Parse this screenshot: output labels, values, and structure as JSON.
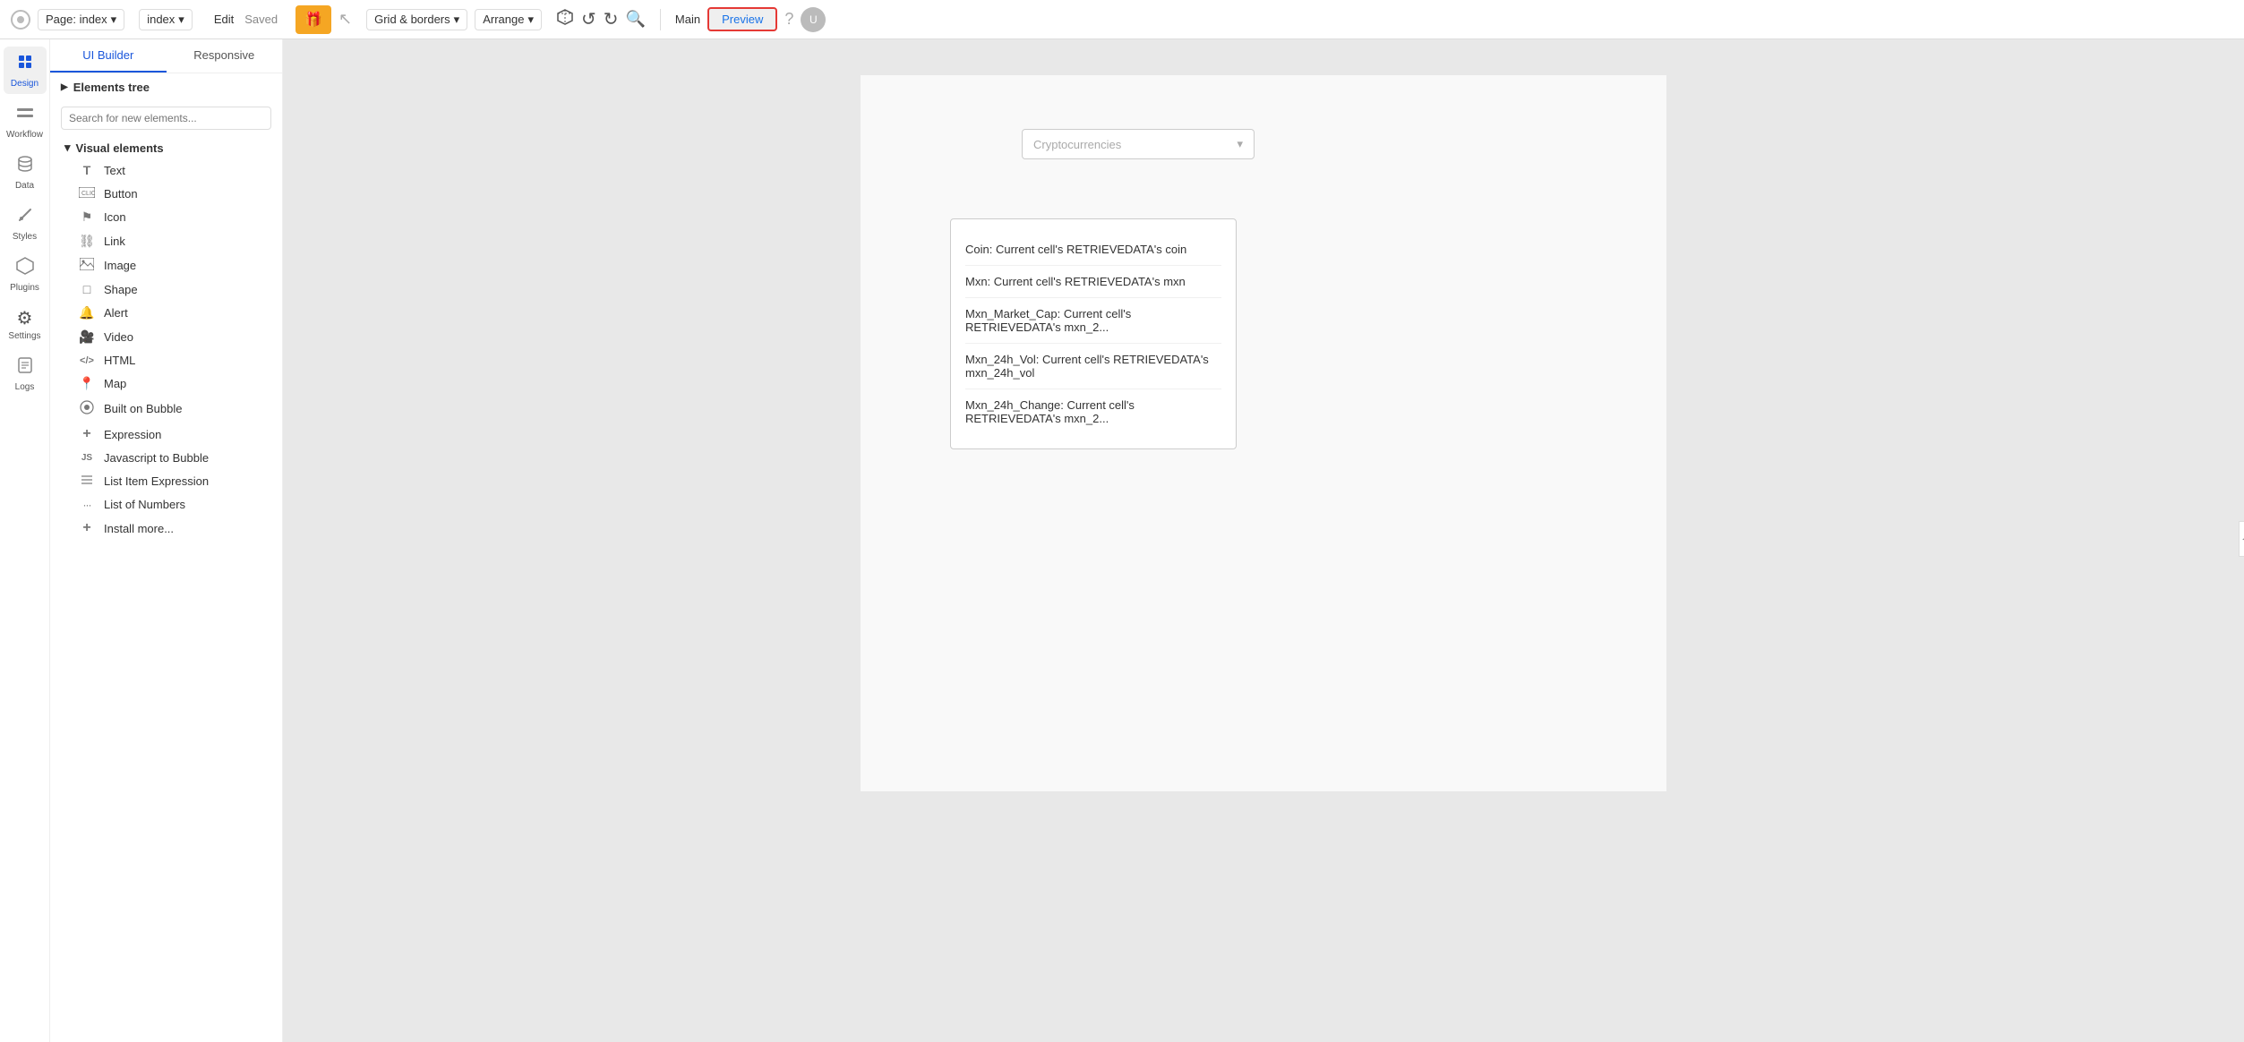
{
  "topbar": {
    "logo": "○",
    "page_label": "Page: index",
    "page_dropdown": "▾",
    "index_label": "index",
    "index_dropdown": "▾",
    "edit_label": "Edit",
    "saved_label": "Saved",
    "gift_icon": "🎁",
    "pointer_icon": "↖",
    "grid_label": "Grid & borders",
    "grid_dropdown": "▾",
    "arrange_label": "Arrange",
    "arrange_dropdown": "▾",
    "cube_icon": "⬡",
    "undo_icon": "↺",
    "redo_icon": "↻",
    "search_icon": "🔍",
    "main_label": "Main",
    "preview_label": "Preview",
    "help_icon": "?",
    "avatar_label": "U"
  },
  "leftnav": {
    "items": [
      {
        "id": "design",
        "icon": "✦",
        "label": "Design",
        "active": true
      },
      {
        "id": "workflow",
        "icon": "⊞",
        "label": "Workflow",
        "active": false
      },
      {
        "id": "data",
        "icon": "◉",
        "label": "Data",
        "active": false
      },
      {
        "id": "styles",
        "icon": "✏",
        "label": "Styles",
        "active": false
      },
      {
        "id": "plugins",
        "icon": "⬡",
        "label": "Plugins",
        "active": false
      },
      {
        "id": "settings",
        "icon": "⚙",
        "label": "Settings",
        "active": false
      },
      {
        "id": "logs",
        "icon": "📄",
        "label": "Logs",
        "active": false
      }
    ]
  },
  "sidebar": {
    "tabs": [
      {
        "id": "ui-builder",
        "label": "UI Builder",
        "active": true
      },
      {
        "id": "responsive",
        "label": "Responsive",
        "active": false
      }
    ],
    "elements_tree": {
      "label": "Elements tree",
      "expanded": true
    },
    "search_placeholder": "Search for new elements...",
    "visual_elements": {
      "label": "Visual elements",
      "expanded": true,
      "items": [
        {
          "id": "text",
          "icon": "T",
          "icon_type": "text",
          "label": "Text"
        },
        {
          "id": "button",
          "icon": "▣",
          "icon_type": "button",
          "label": "Button"
        },
        {
          "id": "icon",
          "icon": "⚑",
          "icon_type": "icon",
          "label": "Icon"
        },
        {
          "id": "link",
          "icon": "⛓",
          "icon_type": "link",
          "label": "Link"
        },
        {
          "id": "image",
          "icon": "⊡",
          "icon_type": "image",
          "label": "Image"
        },
        {
          "id": "shape",
          "icon": "□",
          "icon_type": "shape",
          "label": "Shape"
        },
        {
          "id": "alert",
          "icon": "🔔",
          "icon_type": "alert",
          "label": "Alert"
        },
        {
          "id": "video",
          "icon": "🎥",
          "icon_type": "video",
          "label": "Video"
        },
        {
          "id": "html",
          "icon": "</>",
          "icon_type": "html",
          "label": "HTML"
        },
        {
          "id": "map",
          "icon": "📍",
          "icon_type": "map",
          "label": "Map"
        },
        {
          "id": "builtonbubble",
          "icon": "○",
          "icon_type": "bubble",
          "label": "Built on Bubble"
        },
        {
          "id": "expression",
          "icon": "+",
          "icon_type": "expression",
          "label": "Expression"
        },
        {
          "id": "javascript",
          "icon": "JS",
          "icon_type": "js",
          "label": "Javascript to Bubble"
        },
        {
          "id": "listitemexpression",
          "icon": "☰",
          "icon_type": "list",
          "label": "List Item Expression"
        },
        {
          "id": "listofnumbers",
          "icon": "···",
          "icon_type": "numbers",
          "label": "List of Numbers"
        },
        {
          "id": "installmore",
          "icon": "+",
          "icon_type": "install",
          "label": "Install more..."
        }
      ]
    }
  },
  "canvas": {
    "dropdown": {
      "placeholder": "Cryptocurrencies",
      "arrow": "▾"
    },
    "table": {
      "rows": [
        {
          "label": "Coin: Current cell's RETRIEVEDATA's coin"
        },
        {
          "label": "Mxn: Current cell's RETRIEVEDATA's mxn"
        },
        {
          "label": "Mxn_Market_Cap: Current cell's RETRIEVEDATA's mxn_2..."
        },
        {
          "label": "Mxn_24h_Vol: Current cell's RETRIEVEDATA's mxn_24h_vol"
        },
        {
          "label": "Mxn_24h_Change: Current cell's RETRIEVEDATA's mxn_2..."
        }
      ]
    }
  }
}
